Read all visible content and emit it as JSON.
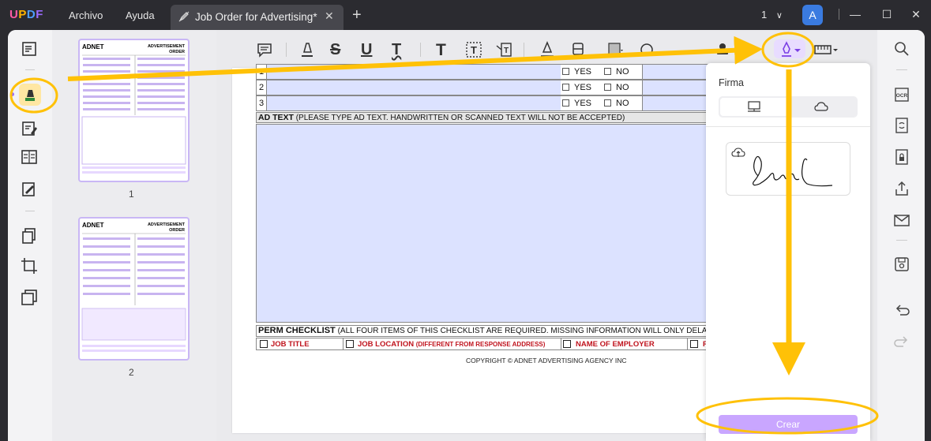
{
  "app": {
    "logo": "UPDF",
    "menu": [
      "Archivo",
      "Ayuda"
    ],
    "tab_title": "Job Order for Advertising*",
    "page_selector": "1",
    "avatar_letter": "A"
  },
  "thumbnails": [
    {
      "page": "1"
    },
    {
      "page": "2"
    }
  ],
  "thumb_text": {
    "logo": "ADNET",
    "heading_line1": "ADVERTISEMENT",
    "heading_line2": "ORDER"
  },
  "form": {
    "rows": [
      {
        "num": "1",
        "yes": "YES",
        "no": "NO"
      },
      {
        "num": "2",
        "yes": "YES",
        "no": "NO"
      },
      {
        "num": "3",
        "yes": "YES",
        "no": "NO"
      }
    ],
    "ad_text_label": "AD TEXT",
    "ad_text_note": "(PLEASE TYPE AD TEXT. HANDWRITTEN OR SCANNED TEXT WILL NOT BE ACCEPTED)",
    "perm_label": "PERM CHECKLIST",
    "perm_note": "(ALL FOUR ITEMS OF THIS CHECKLIST ARE REQUIRED. MISSING INFORMATION WILL ONLY DELAY THE PROCESSING OF THIS",
    "perm_items": [
      {
        "label": "JOB TITLE",
        "note": ""
      },
      {
        "label": "JOB LOCATION",
        "note": "(DIFFERENT FROM RESPONSE ADDRESS)"
      },
      {
        "label": "NAME OF EMPLOYER",
        "note": ""
      },
      {
        "label": "R",
        "note": ""
      }
    ],
    "copyright": "COPYRIGHT © ADNET ADVERTISING AGENCY INC"
  },
  "signature_panel": {
    "title": "Firma",
    "create_label": "Crear"
  },
  "colors": {
    "accent": "#9b6bff",
    "annotation": "#ffc107",
    "form_fill": "#dce2ff",
    "required_red": "#c0141e"
  }
}
